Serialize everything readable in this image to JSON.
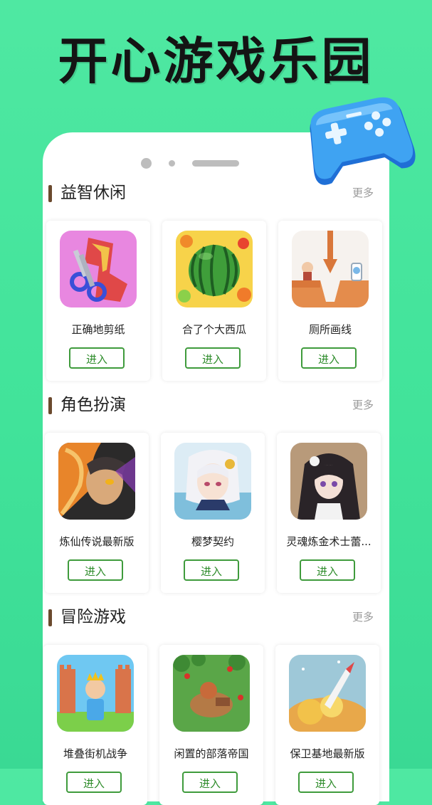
{
  "banner": {
    "title": "开心游戏乐园"
  },
  "sections": [
    {
      "title": "益智休闲",
      "more": "更多",
      "games": [
        {
          "name": "正确地剪纸",
          "button": "进入",
          "icon": "paper-cutting-scissors-icon"
        },
        {
          "name": "合了个大西瓜",
          "button": "进入",
          "icon": "watermelon-icon"
        },
        {
          "name": "厕所画线",
          "button": "进入",
          "icon": "toilet-line-puzzle-icon"
        }
      ]
    },
    {
      "title": "角色扮演",
      "more": "更多",
      "games": [
        {
          "name": "炼仙传说最新版",
          "button": "进入",
          "icon": "fantasy-warrior-icon"
        },
        {
          "name": "樱梦契约",
          "button": "进入",
          "icon": "anime-girl-icon"
        },
        {
          "name": "灵魂炼金术士蕾...",
          "button": "进入",
          "icon": "dark-haired-girl-icon"
        }
      ]
    },
    {
      "title": "冒险游戏",
      "more": "更多",
      "games": [
        {
          "name": "堆叠街机战争",
          "button": "进入",
          "icon": "castle-king-icon"
        },
        {
          "name": "闲置的部落帝国",
          "button": "进入",
          "icon": "tribe-village-icon"
        },
        {
          "name": "保卫基地最新版",
          "button": "进入",
          "icon": "rocket-base-icon"
        }
      ]
    }
  ]
}
